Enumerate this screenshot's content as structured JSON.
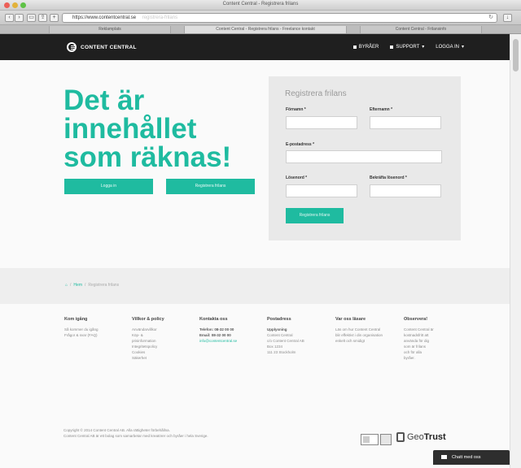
{
  "browser": {
    "window_title": "Content Central - Registrera frilans",
    "url": "https://www.contentcentral.se",
    "url_hint": "registrera-frilans",
    "tabs": [
      "Reklamplats",
      "Content Central - Registrera frilans - Freelance kontakt",
      "Content Central - Frilansinfo"
    ]
  },
  "site": {
    "logo_text": "CONTENT CENTRAL",
    "nav": {
      "item1": "BYRÅER",
      "item2": "SUPPORT",
      "login": "LOGGA IN"
    }
  },
  "hero": {
    "headline_line1": "Det är",
    "headline_line2": "innehållet",
    "headline_line3": "som räknas!",
    "button_left": "Logga in",
    "button_right": "Registrera frilans"
  },
  "form": {
    "title": "Registrera frilans",
    "first_name_label": "Förnamn *",
    "last_name_label": "Efternamn *",
    "email_label": "E-postadress *",
    "password_label": "Lösenord *",
    "confirm_label": "Bekräfta lösenord *",
    "submit_label": "Registrera frilans"
  },
  "breadcrumb": {
    "separator": "/",
    "home": "Hem",
    "current": "Registrera frilans"
  },
  "footer": {
    "col1": {
      "head": "Kom igång",
      "items": [
        "Så kommer du igång",
        "Frågor & svar (FAQ)"
      ]
    },
    "col2": {
      "head": "Villkor & policy",
      "items": [
        "Användarvillkor",
        "Köp- &",
        "prisinformation",
        "Integritetspolicy",
        "Cookies",
        "Säkerhet"
      ]
    },
    "col3": {
      "head": "Kontakta oss",
      "items": [
        "Telefon: 08-32 00 00",
        "Email: 08-32 00 00",
        "info@contentcentral.se"
      ]
    },
    "col4": {
      "head": "Postadress",
      "items": [
        "Upplysning",
        "Content Central",
        "c/o Content Central AB",
        "Box 1234",
        "111 23 Stockholm"
      ]
    },
    "col5": {
      "head": "Var oss läsare",
      "items": [
        "Läs om hur Content Central",
        "blir effektivt i din organisation",
        "enkelt och smidigt"
      ]
    },
    "col6": {
      "head": "Observera!",
      "items": [
        "Content Central är",
        "kostnadsfritt att",
        "använda för dig",
        "som är frilans",
        "och för alla",
        "byråer."
      ]
    },
    "copyright_line1": "Copyright © 2014 Content Central AB. Alla rättigheter förbehållna.",
    "copyright_line2": "Content Central AB är ett bolag som samarbetar med kreatörer och byråer i hela Sverige.",
    "geotrust_text": "Geo",
    "geotrust_bold": "Trust",
    "chat_label": "Chatt med oss"
  }
}
